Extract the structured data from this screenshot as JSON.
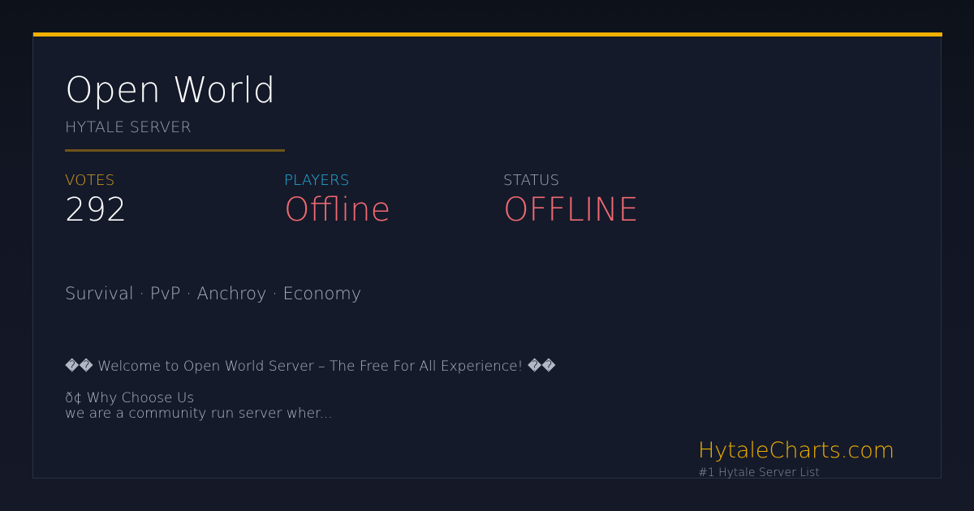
{
  "server": {
    "name": "Open World",
    "category": "HYTALE SERVER"
  },
  "stats": {
    "votes": {
      "label": "VOTES",
      "value": "292"
    },
    "players": {
      "label": "PLAYERS",
      "value": "Offline"
    },
    "status": {
      "label": "STATUS",
      "value": "OFFLINE"
    }
  },
  "tags": "Survival · PvP · Anchroy · Economy",
  "description": {
    "line1": "�� Welcome to Open World Server – The Free For All Experience! ��",
    "line2": "ð¢ Why Choose Us",
    "line3": "we are a community run server wher..."
  },
  "brand": {
    "name": "HytaleCharts.com",
    "tagline": "#1 Hytale Server List"
  },
  "colors": {
    "accent": "#f0b000",
    "players_label": "#23b7e6",
    "offline": "#f06a72",
    "background": "#151a2a"
  }
}
